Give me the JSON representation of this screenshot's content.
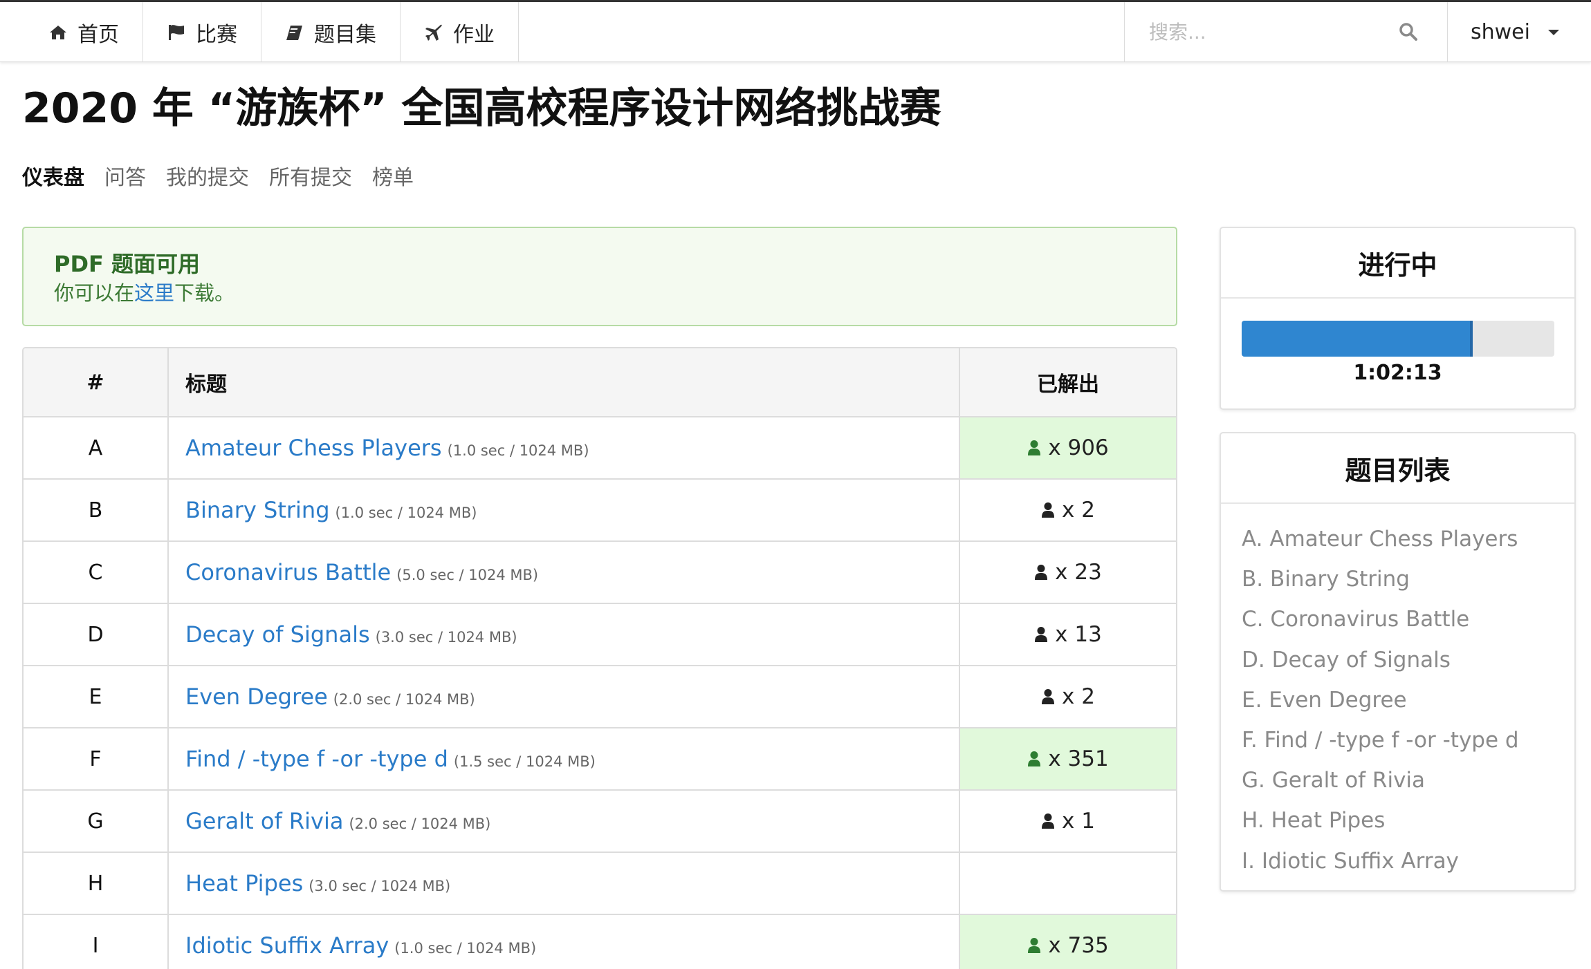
{
  "nav": {
    "items": [
      {
        "label": "首页",
        "icon": "home-icon"
      },
      {
        "label": "比赛",
        "icon": "flag-icon"
      },
      {
        "label": "题目集",
        "icon": "book-icon"
      },
      {
        "label": "作业",
        "icon": "plane-icon"
      }
    ],
    "search_placeholder": "搜索...",
    "username": "shwei"
  },
  "page_title": "2020 年 “游族杯” 全国高校程序设计网络挑战赛",
  "tabs": [
    {
      "label": "仪表盘",
      "active": true
    },
    {
      "label": "问答"
    },
    {
      "label": "我的提交"
    },
    {
      "label": "所有提交"
    },
    {
      "label": "榜单"
    }
  ],
  "alert": {
    "title": "PDF 题面可用",
    "text_before": "你可以在",
    "link": "这里",
    "text_after": "下载。"
  },
  "table": {
    "headers": {
      "id": "#",
      "title": "标题",
      "solved": "已解出"
    },
    "rows": [
      {
        "id": "A",
        "title": "Amateur Chess Players",
        "limit": "(1.0 sec / 1024 MB)",
        "solved": "x 906",
        "highlight": true
      },
      {
        "id": "B",
        "title": "Binary String",
        "limit": "(1.0 sec / 1024 MB)",
        "solved": "x 2",
        "highlight": false
      },
      {
        "id": "C",
        "title": "Coronavirus Battle",
        "limit": "(5.0 sec / 1024 MB)",
        "solved": "x 23",
        "highlight": false
      },
      {
        "id": "D",
        "title": "Decay of Signals",
        "limit": "(3.0 sec / 1024 MB)",
        "solved": "x 13",
        "highlight": false
      },
      {
        "id": "E",
        "title": "Even Degree",
        "limit": "(2.0 sec / 1024 MB)",
        "solved": "x 2",
        "highlight": false
      },
      {
        "id": "F",
        "title": "Find / -type f -or -type d",
        "limit": "(1.5 sec / 1024 MB)",
        "solved": "x 351",
        "highlight": true
      },
      {
        "id": "G",
        "title": "Geralt of Rivia",
        "limit": "(2.0 sec / 1024 MB)",
        "solved": "x 1",
        "highlight": false
      },
      {
        "id": "H",
        "title": "Heat Pipes",
        "limit": "(3.0 sec / 1024 MB)",
        "solved": "",
        "highlight": false
      },
      {
        "id": "I",
        "title": "Idiotic Suffix Array",
        "limit": "(1.0 sec / 1024 MB)",
        "solved": "x 735",
        "highlight": true
      }
    ]
  },
  "status_card": {
    "title": "进行中",
    "progress_fraction": 0.74,
    "time": "1:02:13"
  },
  "problem_list": {
    "title": "题目列表",
    "items": [
      "A. Amateur Chess Players",
      "B. Binary String",
      "C. Coronavirus Battle",
      "D. Decay of Signals",
      "E. Even Degree",
      "F. Find / -type f -or -type d",
      "G. Geralt of Rivia",
      "H. Heat Pipes",
      "I. Idiotic Suffix Array"
    ]
  },
  "colors": {
    "link": "#2a7bc8",
    "solved_highlight": "#e1f9db",
    "solved_icon_ok": "#2e7d32",
    "progress": "#2f86d0",
    "alert_bg": "#f4faf0"
  }
}
